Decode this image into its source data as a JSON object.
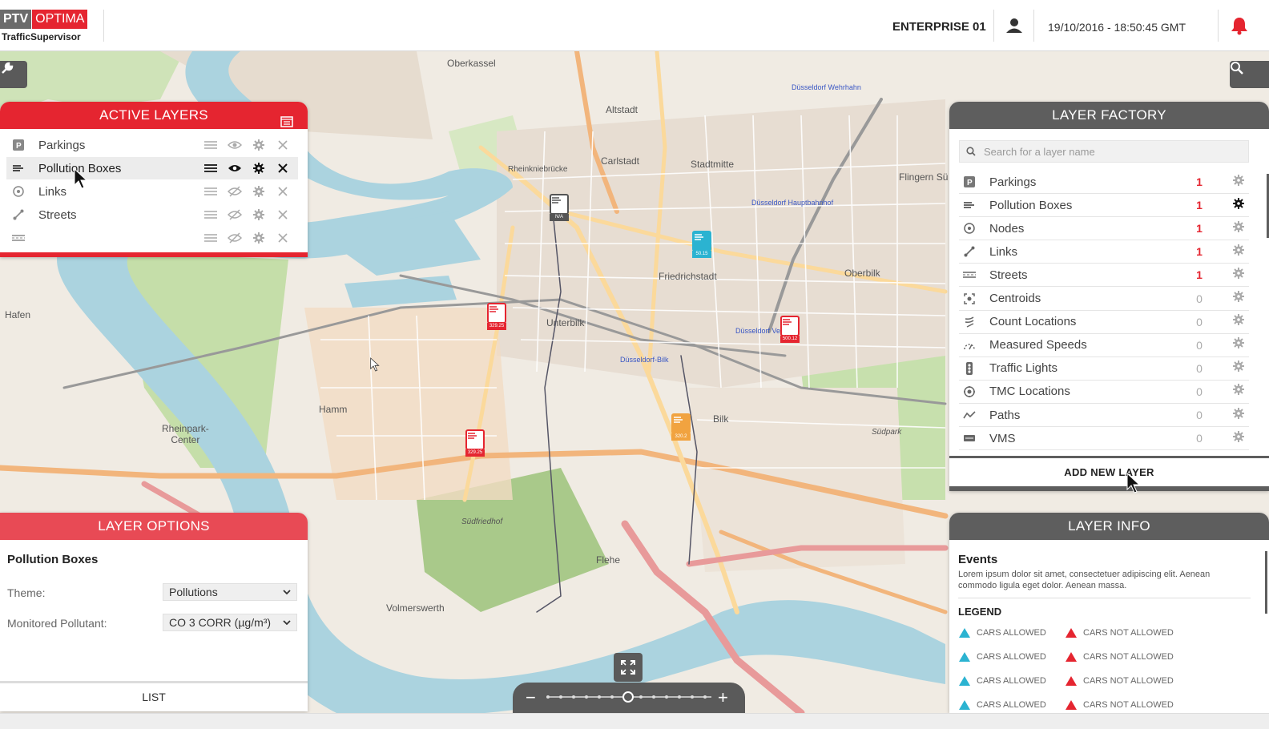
{
  "header": {
    "logo_ptv": "PTV",
    "logo_optima": "OPTIMA",
    "logo_sub": "TrafficSupervisor",
    "enterprise": "ENTERPRISE 01",
    "datetime": "19/10/2016  -  18:50:45 GMT",
    "user_icon": "user-icon",
    "bell_icon": "bell-icon"
  },
  "colors": {
    "accent_red": "#e52530",
    "panel_grey": "#5e5e5e",
    "teal": "#2bb3d1",
    "orange": "#f1a340"
  },
  "map": {
    "labels": {
      "oberkassel": "Oberkassel",
      "altstadt": "Altstadt",
      "carlstadt": "Carlstadt",
      "stadtmitte": "Stadtmitte",
      "rheinkniebrucke": "Rheinkniebrücke",
      "friedrichstadt": "Friedrichstadt",
      "oberbilk": "Oberbilk",
      "unterbilk": "Unterbilk",
      "hafen": "Hafen",
      "hamm": "Hamm",
      "rheinpark": "Rheinpark-\nCenter",
      "bilk": "Bilk",
      "flehe": "Flehe",
      "volmerswerth": "Volmerswerth",
      "sudfriedhof": "Südfriedhof",
      "sudpark": "Südpark",
      "flingern": "Flingern Sü",
      "hbf": "Düsseldorf Hauptbahnhof",
      "wehrhahn": "Düsseldorf Wehrhahn",
      "bilk_station": "Düsseldorf-Bilk",
      "oberbilk_station": "Düsseldorf Ve    rten"
    },
    "markers": [
      {
        "value": "N/A",
        "style": "grey"
      },
      {
        "value": "50.15",
        "style": "teal"
      },
      {
        "value": "329.25",
        "style": "red"
      },
      {
        "value": "500.12",
        "style": "red"
      },
      {
        "value": "329.25",
        "style": "red"
      },
      {
        "value": "320.2",
        "style": "orange"
      }
    ],
    "tools_icon": "wrench-icon",
    "search_icon": "search-icon",
    "fullscreen_icon": "fullscreen-icon",
    "zoom_minus": "−",
    "zoom_plus": "+",
    "zoom_level": 0.5
  },
  "active_layers": {
    "title": "ACTIVE LAYERS",
    "calendar_icon": "calendar-icon",
    "items": [
      {
        "name": "Parkings",
        "icon": "parking-icon",
        "visible": true
      },
      {
        "name": "Pollution Boxes",
        "icon": "pollution-icon",
        "visible": true
      },
      {
        "name": "Links",
        "icon": "node-icon",
        "visible": false
      },
      {
        "name": "Streets",
        "icon": "link-icon",
        "visible": false
      },
      {
        "name": "",
        "icon": "street-icon",
        "visible": false
      }
    ]
  },
  "layer_factory": {
    "title": "LAYER FACTORY",
    "search_placeholder": "Search for a layer name",
    "items": [
      {
        "name": "Parkings",
        "count": "1",
        "icon": "parking-icon"
      },
      {
        "name": "Pollution Boxes",
        "count": "1",
        "icon": "pollution-icon"
      },
      {
        "name": "Nodes",
        "count": "1",
        "icon": "node-icon"
      },
      {
        "name": "Links",
        "count": "1",
        "icon": "link-icon"
      },
      {
        "name": "Streets",
        "count": "1",
        "icon": "street-icon"
      },
      {
        "name": "Centroids",
        "count": "0",
        "icon": "centroid-icon"
      },
      {
        "name": "Count Locations",
        "count": "0",
        "icon": "count-location-icon"
      },
      {
        "name": "Measured Speeds",
        "count": "0",
        "icon": "speed-icon"
      },
      {
        "name": "Traffic Lights",
        "count": "0",
        "icon": "traffic-light-icon"
      },
      {
        "name": "TMC Locations",
        "count": "0",
        "icon": "tmc-icon"
      },
      {
        "name": "Paths",
        "count": "0",
        "icon": "path-icon"
      },
      {
        "name": "VMS",
        "count": "0",
        "icon": "vms-icon"
      }
    ],
    "add_label": "ADD NEW LAYER"
  },
  "layer_options": {
    "title": "LAYER OPTIONS",
    "layer_name": "Pollution Boxes",
    "theme_label": "Theme:",
    "theme_value": "Pollutions",
    "pollutant_label": "Monitored Pollutant:",
    "pollutant_value": "CO 3 CORR (µg/m³)",
    "list_label": "LIST"
  },
  "layer_info": {
    "title": "LAYER INFO",
    "events_title": "Events",
    "description": "Lorem ipsum dolor sit amet, consectetuer adipiscing elit. Aenean commodo ligula eget dolor. Aenean massa.",
    "legend_title": "LEGEND",
    "legend_allowed": "CARS ALLOWED",
    "legend_not_allowed": "CARS NOT ALLOWED"
  }
}
